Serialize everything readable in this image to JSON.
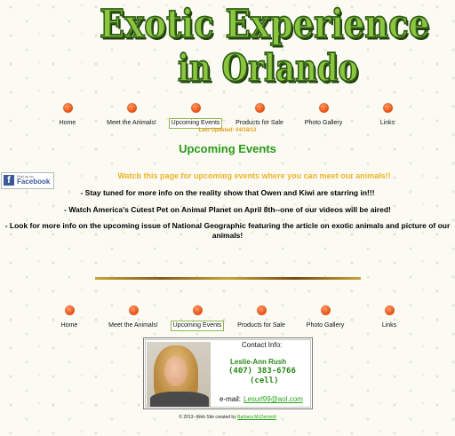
{
  "logo": {
    "line1": "Exotic Experience",
    "line2": "in Orlando"
  },
  "nav": [
    "Home",
    "Meet the Animals!",
    "Upcoming Events",
    "Products for Sale",
    "Photo Gallery",
    "Links"
  ],
  "last_updated": "Last Updated: 04/18/13",
  "page_title": "Upcoming Events",
  "facebook": {
    "find_us": "Find us on",
    "name": "Facebook",
    "icon": "facebook-icon"
  },
  "intro": "Watch this page for upcoming events where you can meet our animals!!",
  "news": [
    "- Stay tuned for more info on the reality show that Owen and Kiwi are starring in!!!",
    "- Watch America's Cutest Pet on Animal Planet on April 8th--one of our videos will be aired!",
    "- Look for more info on the upcoming issue of National Geographic  featuring the article on exotic animals and picture of our animals!"
  ],
  "contact": {
    "label": "Contact Info:",
    "name": "Leslie-Ann Rush",
    "phone": "(407) 383-6766",
    "phone_note": "(cell)",
    "email_label": "e-mail:",
    "email": "Lesurl99@aol.com"
  },
  "footer": {
    "text": "© 2013--Web Site created by ",
    "link": "Barbara McDermott"
  },
  "colors": {
    "accent_green": "#2c9a1a",
    "nav_dot": "#e8571c",
    "intro_yellow": "#f0b429"
  }
}
